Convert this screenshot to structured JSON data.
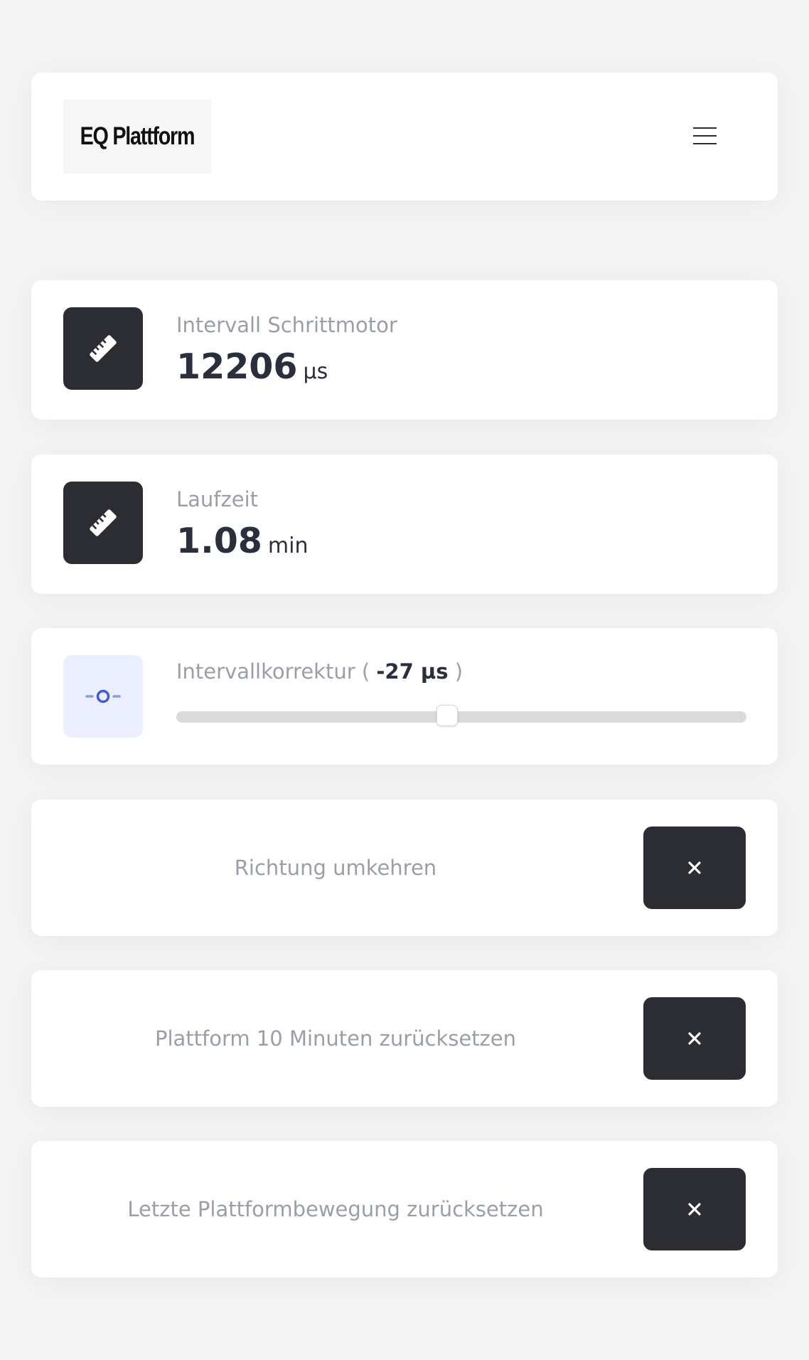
{
  "header": {
    "logo_text": "EQ Plattform",
    "menu_icon": "hamburger-menu-icon"
  },
  "stats": [
    {
      "label": "Intervall Schrittmotor",
      "value": "12206",
      "unit": "µs",
      "icon": "ruler-icon"
    },
    {
      "label": "Laufzeit",
      "value": "1.08",
      "unit": "min",
      "icon": "ruler-icon"
    }
  ],
  "slider": {
    "label_prefix": "Intervallkorrektur ( ",
    "value": "-27 µs",
    "label_suffix": " )",
    "position": 0.475,
    "icon": "slider-icon"
  },
  "actions": [
    {
      "label": "Richtung umkehren",
      "icon": "close-icon"
    },
    {
      "label": "Plattform 10 Minuten zurücksetzen",
      "icon": "close-icon"
    },
    {
      "label": "Letzte Plattformbewegung zurücksetzen",
      "icon": "close-icon"
    }
  ],
  "colors": {
    "background": "#f3f3f4",
    "card": "#ffffff",
    "dark": "#2c2d33",
    "accent": "#3f5bd6",
    "muted_text": "#9a9ea8"
  }
}
